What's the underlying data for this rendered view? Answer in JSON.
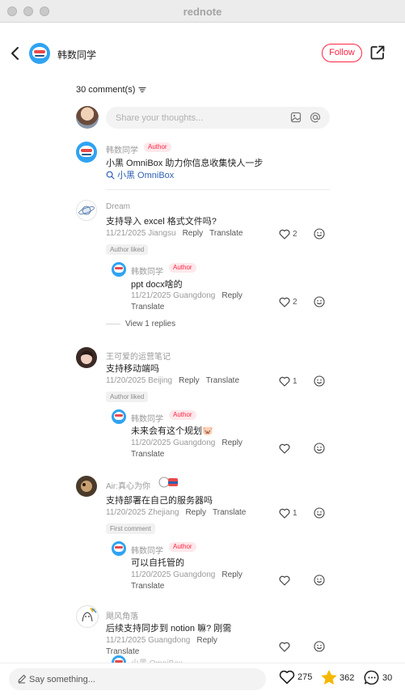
{
  "window": {
    "title": "rednote"
  },
  "header": {
    "author_name": "韩数同学",
    "follow_label": "Follow"
  },
  "comments_header": {
    "count_label": "30 comment(s)"
  },
  "composer": {
    "placeholder": "Share your thoughts..."
  },
  "pinned": {
    "user": "韩数同学",
    "tag": "Author",
    "text": "小黑 OmniBox 助力你信息收集快人一步",
    "search_link": "小黑 OmniBox"
  },
  "comments": [
    {
      "user": "Dream",
      "text": "支持导入 excel 格式文件吗?",
      "date_location": "11/21/2025 Jiangsu",
      "reply": "Reply",
      "translate": "Translate",
      "likes": "2",
      "liked_tag": "Author liked",
      "reply_item": {
        "user": "韩数同学",
        "tag": "Author",
        "text": "ppt docx啥的",
        "date_location": "11/21/2025 Guangdong",
        "reply": "Reply",
        "translate": "Translate",
        "likes": "2"
      },
      "view_replies": "View 1 replies"
    },
    {
      "user": "王可爱的运营笔记",
      "text": "支持移动端吗",
      "date_location": "11/20/2025 Beijing",
      "reply": "Reply",
      "translate": "Translate",
      "likes": "1",
      "liked_tag": "Author liked",
      "reply_item": {
        "user": "韩数同学",
        "tag": "Author",
        "text": "未来会有这个规划🐷",
        "date_location": "11/20/2025 Guangdong",
        "reply": "Reply",
        "translate": "Translate",
        "likes": ""
      }
    },
    {
      "user": "Air:真心为你",
      "text": "支持部署在自己的服务器吗",
      "date_location": "11/20/2025 Zhejiang",
      "reply": "Reply",
      "translate": "Translate",
      "likes": "1",
      "liked_tag": "First comment",
      "reply_item": {
        "user": "韩数同学",
        "tag": "Author",
        "text": "可以自托管的",
        "date_location": "11/20/2025 Guangdong",
        "reply": "Reply",
        "translate": "Translate",
        "likes": ""
      }
    },
    {
      "user": "飓风角落",
      "text": "后续支持同步到 notion 嘛? 刚需",
      "date_location": "11/21/2025 Guangdong",
      "reply": "Reply",
      "translate": "Translate",
      "likes": ""
    }
  ],
  "partial_item": "小黑 OmniBox",
  "bottom": {
    "placeholder": "Say something...",
    "likes": "275",
    "stars": "362",
    "comments": "30"
  },
  "colors": {
    "accent": "#ff2442",
    "avatar_blue": "#2fa3f2",
    "star": "#f5b800"
  }
}
